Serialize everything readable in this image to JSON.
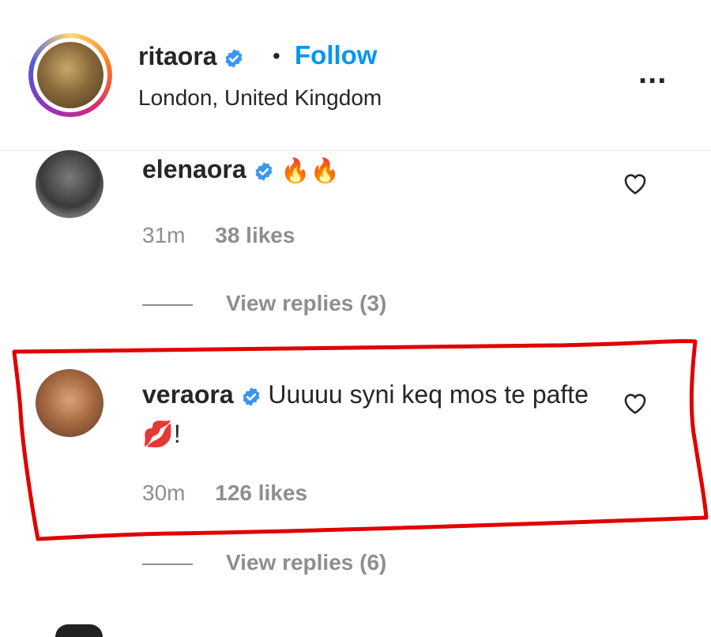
{
  "post_header": {
    "username": "ritaora",
    "separator": "•",
    "follow_label": "Follow",
    "location": "London, United Kingdom",
    "more_label": "..."
  },
  "comments": [
    {
      "username": "elenaora",
      "text": "🔥🔥",
      "time": "31m",
      "likes": "38 likes",
      "view_replies": "View replies (3)"
    },
    {
      "username": "veraora",
      "text": "Uuuuu syni keq mos te pafte 💋!",
      "time": "30m",
      "likes": "126 likes",
      "view_replies": "View replies (6)"
    }
  ],
  "colors": {
    "link_blue": "#0095f6",
    "verified_blue": "#3897f0",
    "meta_gray": "#8e8e8e",
    "highlight_red": "#e00000"
  }
}
